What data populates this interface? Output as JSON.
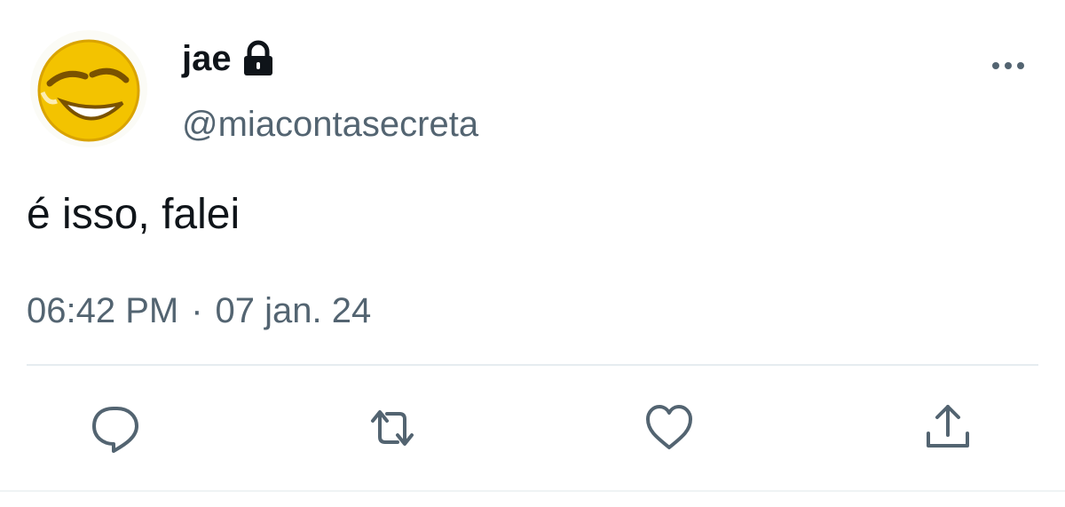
{
  "tweet": {
    "display_name": "jae",
    "handle": "@miacontasecreta",
    "text": "é isso, falei",
    "time": "06:42 PM",
    "separator": "·",
    "date": "07 jan. 24",
    "protected_icon": "lock-icon",
    "avatar_icon": "laughing-emoji-avatar"
  },
  "actions": {
    "reply_icon": "reply-icon",
    "retweet_icon": "retweet-icon",
    "like_icon": "heart-icon",
    "share_icon": "share-icon",
    "more_icon": "more-icon"
  },
  "colors": {
    "text": "#0f1419",
    "secondary": "#536471",
    "divider": "#e6ecf0",
    "icon": "#536471",
    "avatar_yellow": "#f3c300"
  }
}
